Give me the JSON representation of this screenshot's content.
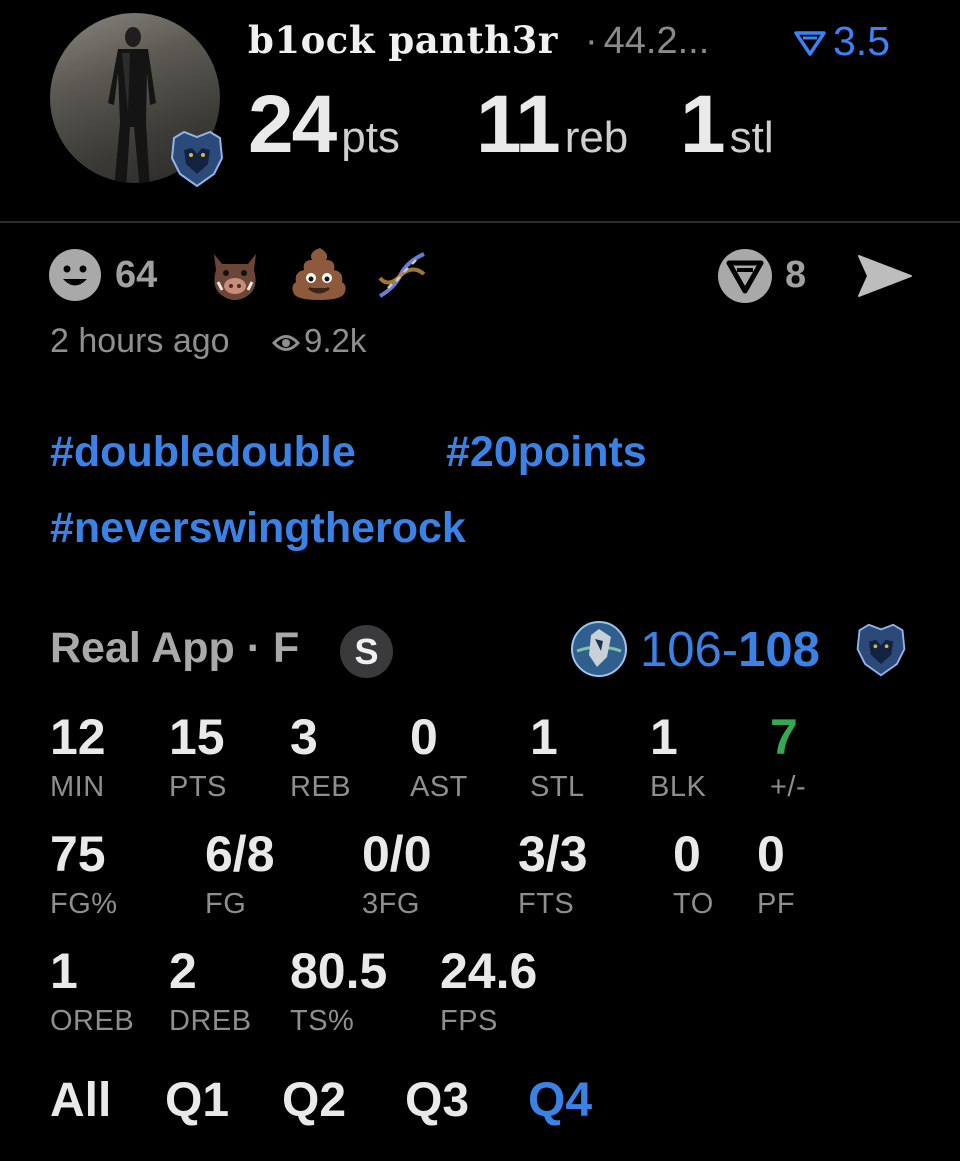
{
  "post": {
    "username": "b1ock panth3r",
    "rating": "44.2...",
    "rating_delta": "3.5",
    "headline_stats": [
      {
        "value": "24",
        "unit": "pts"
      },
      {
        "value": "11",
        "unit": "reb"
      },
      {
        "value": "1",
        "unit": "stl"
      }
    ],
    "reactions": {
      "smiley_count": "64",
      "comment_count": "8"
    },
    "time_ago": "2 hours ago",
    "views": "9.2k",
    "hashtags": [
      "#doubledouble",
      "#20points",
      "#neverswingtherock"
    ]
  },
  "game": {
    "source": "Real App · F",
    "s_badge": "S",
    "score_away": "106",
    "score_sep": "-",
    "score_home": "108",
    "stats_row1": [
      {
        "value": "12",
        "label": "MIN"
      },
      {
        "value": "15",
        "label": "PTS"
      },
      {
        "value": "3",
        "label": "REB"
      },
      {
        "value": "0",
        "label": "AST"
      },
      {
        "value": "1",
        "label": "STL"
      },
      {
        "value": "1",
        "label": "BLK"
      },
      {
        "value": "7",
        "label": "+/-"
      }
    ],
    "stats_row2": [
      {
        "value": "75",
        "label": "FG%"
      },
      {
        "value": "6/8",
        "label": "FG"
      },
      {
        "value": "0/0",
        "label": "3FG"
      },
      {
        "value": "3/3",
        "label": "FTS"
      },
      {
        "value": "0",
        "label": "TO"
      },
      {
        "value": "0",
        "label": "PF"
      }
    ],
    "stats_row3": [
      {
        "value": "1",
        "label": "OREB"
      },
      {
        "value": "2",
        "label": "DREB"
      },
      {
        "value": "80.5",
        "label": "TS%"
      },
      {
        "value": "24.6",
        "label": "FPS"
      }
    ],
    "quarter_tabs": [
      "All",
      "Q1",
      "Q2",
      "Q3",
      "Q4"
    ],
    "active_tab": "Q4"
  },
  "colors": {
    "accent_blue": "#3a82e6",
    "positive_green": "#34a853",
    "background": "#000000"
  },
  "icons": [
    "grizzlies-logo-icon",
    "timberwolves-logo-icon",
    "smiley-icon",
    "boar-emoji-icon",
    "poop-emoji-icon",
    "dna-icon",
    "comment-icon",
    "send-icon",
    "eye-icon",
    "rating-triangle-icon"
  ]
}
